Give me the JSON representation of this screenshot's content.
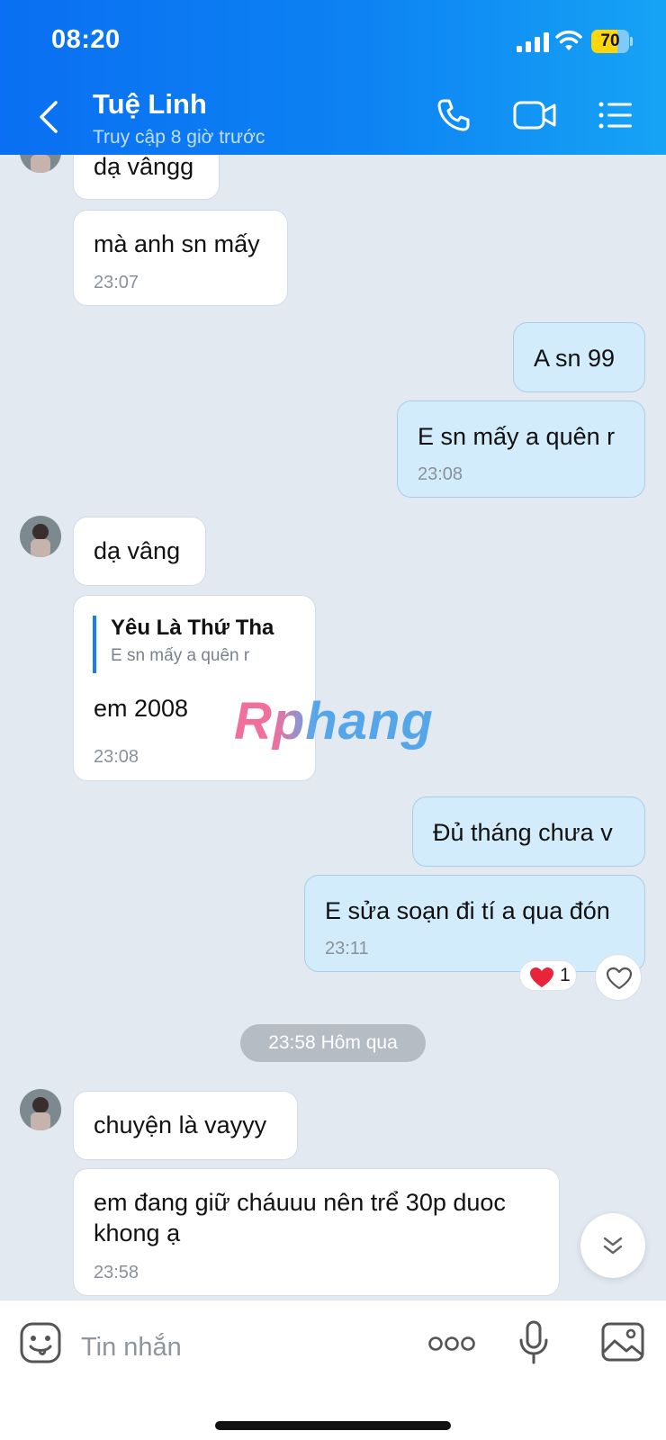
{
  "status_bar": {
    "time": "08:20",
    "battery": "70",
    "battery_level": 0.7
  },
  "header": {
    "contact_name": "Tuệ Linh",
    "contact_status": "Truy cập 8 giờ trước"
  },
  "messages": [
    {
      "dir": "in",
      "text": "dạ vângg"
    },
    {
      "dir": "in",
      "text": "mà anh sn mấy",
      "time": "23:07"
    },
    {
      "dir": "out",
      "text": "A sn 99"
    },
    {
      "dir": "out",
      "text": "E sn mấy a quên r",
      "time": "23:08"
    },
    {
      "dir": "in",
      "text": "dạ vâng"
    },
    {
      "dir": "in",
      "quote": {
        "name": "Yêu Là Thứ Tha",
        "text": "E sn mấy a quên r"
      },
      "text": "em 2008",
      "time": "23:08"
    },
    {
      "dir": "out",
      "text": "Đủ tháng chưa v"
    },
    {
      "dir": "out",
      "text": "E sửa soạn đi tí a qua đón",
      "time": "23:11",
      "reaction": {
        "emoji": "❤️",
        "count": "1"
      }
    },
    {
      "dir": "in",
      "text": "chuyện là vayyy"
    },
    {
      "dir": "in",
      "text": "em đang giữ cháuuu nên trể 30p duoc khong ạ",
      "time": "23:58"
    }
  ],
  "date_separator": "23:58 Hôm qua",
  "watermark": "Rphang",
  "composer": {
    "placeholder": "Tin nhắn"
  },
  "colors": {
    "header": "#0d83f3",
    "outgoing_bubble": "#d3ecfc",
    "incoming_bubble": "#ffffff",
    "background": "#e2e9f1"
  },
  "icons": [
    "back-icon",
    "phone-icon",
    "video-call-icon",
    "menu-list-icon",
    "heart-icon",
    "chevron-double-down-icon",
    "sticker-icon",
    "more-icon",
    "microphone-icon",
    "image-icon"
  ]
}
